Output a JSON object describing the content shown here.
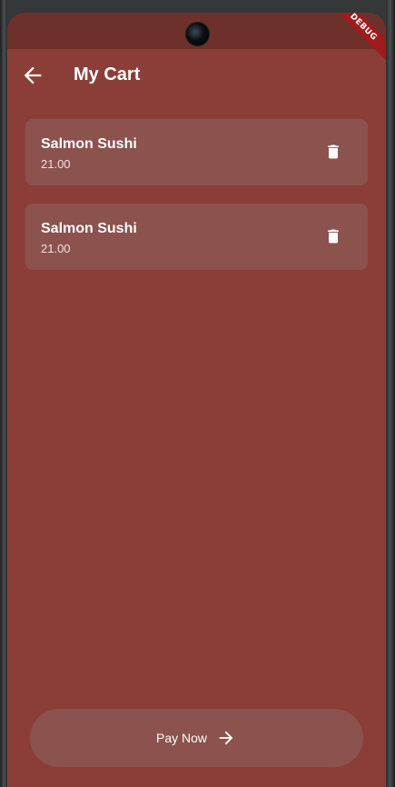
{
  "app": {
    "title": "My Cart",
    "debug_banner": "DEBUG"
  },
  "cart": {
    "items": [
      {
        "name": "Salmon Sushi",
        "price": "21.00"
      },
      {
        "name": "Salmon Sushi",
        "price": "21.00"
      }
    ]
  },
  "footer": {
    "pay_label": "Pay Now"
  },
  "colors": {
    "background": "#8b3e38",
    "card": "#8b524e",
    "status_bar": "#6d302b",
    "text": "#ffffff"
  },
  "icons": {
    "back": "arrow-left-icon",
    "delete": "trash-icon",
    "pay": "arrow-right-icon"
  }
}
